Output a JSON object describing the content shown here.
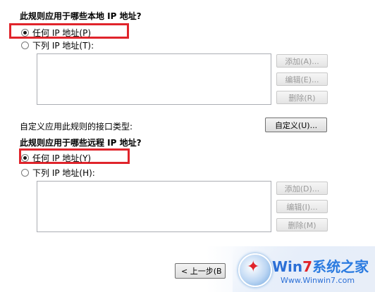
{
  "local": {
    "heading": "此规则应用于哪些本地 IP 地址?",
    "option_any": "任何 IP 地址(P)",
    "option_list": "下列 IP 地址(T):",
    "add": "添加(A)...",
    "edit": "编辑(E)...",
    "remove": "删除(R)"
  },
  "interface": {
    "label": "自定义应用此规则的接口类型:",
    "customize": "自定义(U)..."
  },
  "remote": {
    "heading": "此规则应用于哪些远程 IP 地址?",
    "option_any": "任何 IP 地址(Y)",
    "option_list": "下列 IP 地址(H):",
    "add": "添加(D)...",
    "edit": "编辑(I)...",
    "remove": "删除(M)"
  },
  "footer": {
    "back": "< 上一步(B"
  },
  "watermark": {
    "brand_win": "Win",
    "brand_seven": "7",
    "brand_cn": "系统之家",
    "site": "Www.Winwin7.com"
  },
  "colors": {
    "highlight": "#e0242b",
    "accent": "#2b6fd6"
  }
}
